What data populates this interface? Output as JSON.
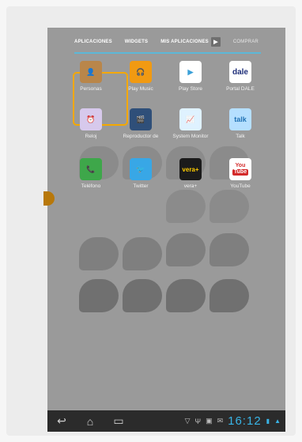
{
  "tabs": [
    {
      "label": "APLICACIONES",
      "active": true
    },
    {
      "label": "WIDGETS",
      "active": false
    },
    {
      "label": "MIS APLICACIONES",
      "active": false
    },
    {
      "label": "COMPRAR",
      "active": false
    }
  ],
  "apps": [
    {
      "label": "Personas",
      "icon": "contacts-icon",
      "color": "#b9864a",
      "glyph": "👤"
    },
    {
      "label": "Play Music",
      "icon": "headphones-icon",
      "color": "#f19a12",
      "glyph": "🎧"
    },
    {
      "label": "Play Store",
      "icon": "play-store-icon",
      "color": "#ffffff",
      "glyph": "▶"
    },
    {
      "label": "Portal DALE",
      "icon": "dale-icon",
      "color": "#ffffff",
      "glyph": "dale"
    },
    {
      "label": "Reloj",
      "icon": "clock-icon",
      "color": "#d7c9ec",
      "glyph": "⏰"
    },
    {
      "label": "Reproductor de",
      "icon": "video-player-icon",
      "color": "#2f4f79",
      "glyph": "🎬"
    },
    {
      "label": "System Monitor",
      "icon": "system-monitor-icon",
      "color": "#dff2ff",
      "glyph": "📈"
    },
    {
      "label": "Talk",
      "icon": "talk-icon",
      "color": "#b5dfff",
      "glyph": "talk"
    },
    {
      "label": "Teléfono",
      "icon": "phone-icon",
      "color": "#3ea74a",
      "glyph": "📞"
    },
    {
      "label": "Twitter",
      "icon": "twitter-icon",
      "color": "#38a7e6",
      "glyph": "🐦"
    },
    {
      "label": "vera+",
      "icon": "vera-icon",
      "color": "#1b1b1b",
      "glyph": "vera+"
    },
    {
      "label": "YouTube",
      "icon": "youtube-icon",
      "color": "#ffffff",
      "glyph": "You Tube"
    }
  ],
  "status": {
    "time": "16:12"
  }
}
